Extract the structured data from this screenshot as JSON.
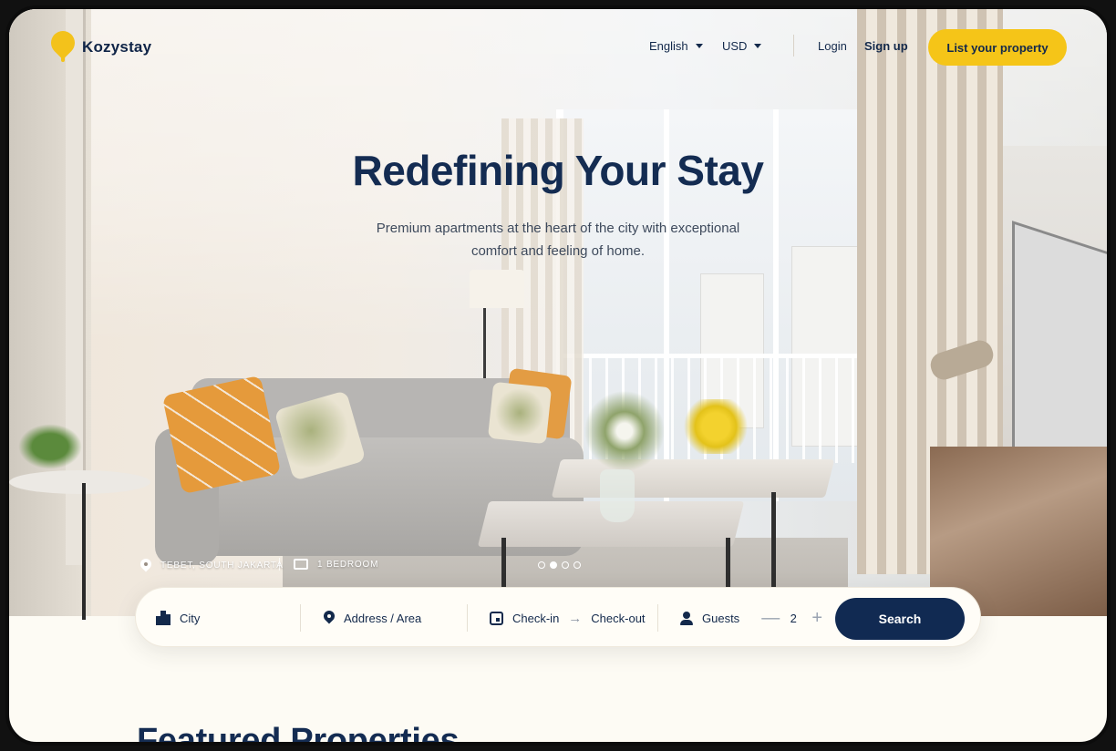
{
  "brand": {
    "name": "Kozystay",
    "accent": "#f5c518",
    "navy": "#112a52"
  },
  "nav": {
    "language": "English",
    "currency": "USD",
    "login": "Login",
    "signup": "Sign up",
    "cta": "List your property"
  },
  "hero": {
    "title": "Redefining Your Stay",
    "subtitle": "Premium apartments at the heart of the city with exceptional comfort and feeling of home.",
    "location": "TEBET, SOUTH JAKARTA",
    "rooms": "1 BEDROOM",
    "carousel": {
      "total": 4,
      "active": 2
    }
  },
  "search": {
    "city": "City",
    "address": "Address / Area",
    "checkin": "Check-in",
    "checkout": "Check-out",
    "guests_label": "Guests",
    "guests": "2",
    "minus": "—",
    "plus": "+",
    "button": "Search"
  },
  "section": {
    "title": "Featured Properties"
  },
  "icons": [
    "logo-icon",
    "caret-down-icon",
    "map-pin-icon",
    "bed-icon",
    "city-icon",
    "calendar-icon",
    "arrow-right-icon",
    "user-icon"
  ]
}
